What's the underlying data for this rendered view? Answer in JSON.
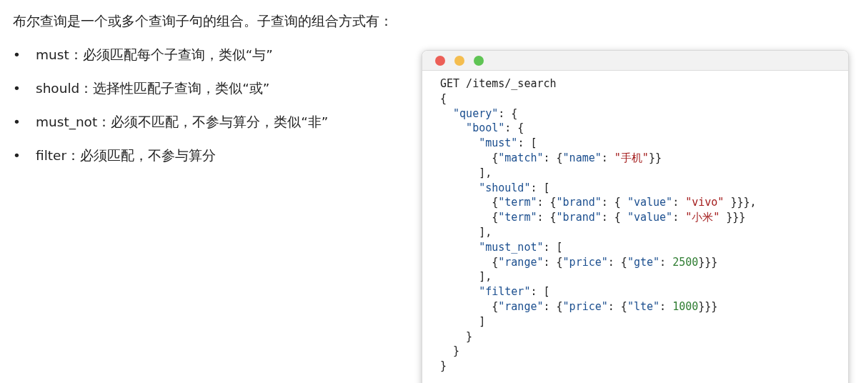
{
  "heading": "布尔查询是一个或多个查询子句的组合。子查询的组合方式有：",
  "bullets": [
    {
      "marker": "•",
      "text": "must：必须匹配每个子查询，类似“与”"
    },
    {
      "marker": "•",
      "text": "should：选择性匹配子查询，类似“或”"
    },
    {
      "marker": "•",
      "text": "must_not：必须不匹配，不参与算分，类似“非”"
    },
    {
      "marker": "•",
      "text": "filter：必须匹配，不参与算分"
    }
  ],
  "code_window": {
    "dots": [
      {
        "color": "#ec5f57"
      },
      {
        "color": "#f4bd4f"
      },
      {
        "color": "#5fc454"
      }
    ],
    "lines": [
      [
        {
          "kind": "plain",
          "text": "GET /items/_search"
        }
      ],
      [
        {
          "kind": "plain",
          "text": "{"
        }
      ],
      [
        {
          "kind": "key",
          "text": "  \"query\""
        },
        {
          "kind": "plain",
          "text": ": {"
        }
      ],
      [
        {
          "kind": "key",
          "text": "    \"bool\""
        },
        {
          "kind": "plain",
          "text": ": {"
        }
      ],
      [
        {
          "kind": "key",
          "text": "      \"must\""
        },
        {
          "kind": "plain",
          "text": ": ["
        }
      ],
      [
        {
          "kind": "plain",
          "text": "        {"
        },
        {
          "kind": "key",
          "text": "\"match\""
        },
        {
          "kind": "plain",
          "text": ": {"
        },
        {
          "kind": "key",
          "text": "\"name\""
        },
        {
          "kind": "plain",
          "text": ": "
        },
        {
          "kind": "string",
          "text": "\"手机\""
        },
        {
          "kind": "plain",
          "text": "}}"
        }
      ],
      [
        {
          "kind": "plain",
          "text": "      ],"
        }
      ],
      [
        {
          "kind": "key",
          "text": "      \"should\""
        },
        {
          "kind": "plain",
          "text": ": ["
        }
      ],
      [
        {
          "kind": "plain",
          "text": "        {"
        },
        {
          "kind": "key",
          "text": "\"term\""
        },
        {
          "kind": "plain",
          "text": ": {"
        },
        {
          "kind": "key",
          "text": "\"brand\""
        },
        {
          "kind": "plain",
          "text": ": { "
        },
        {
          "kind": "key",
          "text": "\"value\""
        },
        {
          "kind": "plain",
          "text": ": "
        },
        {
          "kind": "string",
          "text": "\"vivo\""
        },
        {
          "kind": "plain",
          "text": " }}},"
        }
      ],
      [
        {
          "kind": "plain",
          "text": "        {"
        },
        {
          "kind": "key",
          "text": "\"term\""
        },
        {
          "kind": "plain",
          "text": ": {"
        },
        {
          "kind": "key",
          "text": "\"brand\""
        },
        {
          "kind": "plain",
          "text": ": { "
        },
        {
          "kind": "key",
          "text": "\"value\""
        },
        {
          "kind": "plain",
          "text": ": "
        },
        {
          "kind": "string",
          "text": "\"小米\""
        },
        {
          "kind": "plain",
          "text": " }}}"
        }
      ],
      [
        {
          "kind": "plain",
          "text": "      ],"
        }
      ],
      [
        {
          "kind": "key",
          "text": "      \"must_not\""
        },
        {
          "kind": "plain",
          "text": ": ["
        }
      ],
      [
        {
          "kind": "plain",
          "text": "        {"
        },
        {
          "kind": "key",
          "text": "\"range\""
        },
        {
          "kind": "plain",
          "text": ": {"
        },
        {
          "kind": "key",
          "text": "\"price\""
        },
        {
          "kind": "plain",
          "text": ": {"
        },
        {
          "kind": "key",
          "text": "\"gte\""
        },
        {
          "kind": "plain",
          "text": ": "
        },
        {
          "kind": "number",
          "text": "2500"
        },
        {
          "kind": "plain",
          "text": "}}}"
        }
      ],
      [
        {
          "kind": "plain",
          "text": "      ],"
        }
      ],
      [
        {
          "kind": "key",
          "text": "      \"filter\""
        },
        {
          "kind": "plain",
          "text": ": ["
        }
      ],
      [
        {
          "kind": "plain",
          "text": "        {"
        },
        {
          "kind": "key",
          "text": "\"range\""
        },
        {
          "kind": "plain",
          "text": ": {"
        },
        {
          "kind": "key",
          "text": "\"price\""
        },
        {
          "kind": "plain",
          "text": ": {"
        },
        {
          "kind": "key",
          "text": "\"lte\""
        },
        {
          "kind": "plain",
          "text": ": "
        },
        {
          "kind": "number",
          "text": "1000"
        },
        {
          "kind": "plain",
          "text": "}}}"
        }
      ],
      [
        {
          "kind": "plain",
          "text": "      ]"
        }
      ],
      [
        {
          "kind": "plain",
          "text": "    }"
        }
      ],
      [
        {
          "kind": "plain",
          "text": "  }"
        }
      ],
      [
        {
          "kind": "plain",
          "text": "}"
        }
      ]
    ]
  }
}
